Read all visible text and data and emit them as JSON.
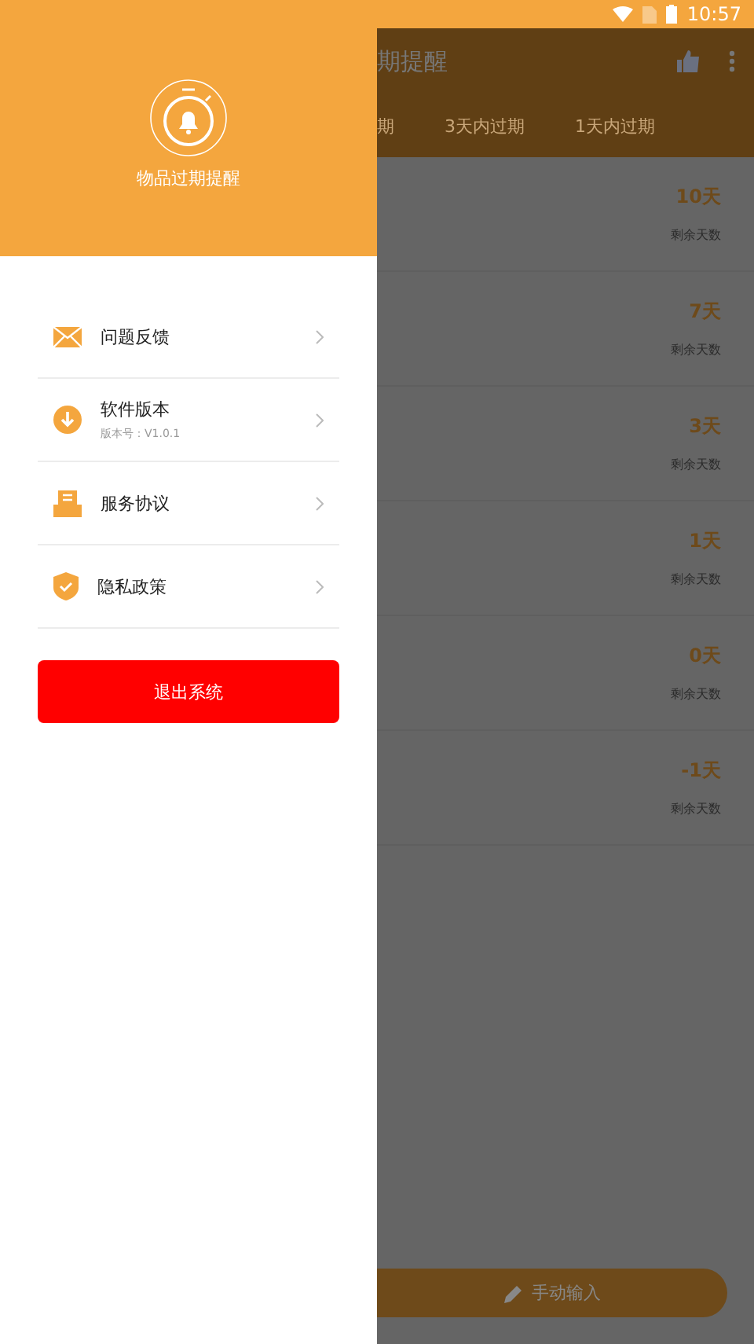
{
  "status_bar": {
    "time": "10:57"
  },
  "drawer": {
    "title": "物品过期提醒",
    "menu": [
      {
        "label": "问题反馈"
      },
      {
        "label": "软件版本",
        "subtitle": "版本号：V1.0.1"
      },
      {
        "label": "服务协议"
      },
      {
        "label": "隐私政策"
      }
    ],
    "logout": "退出系统"
  },
  "background": {
    "title": "期提醒",
    "tabs": [
      "期",
      "3天内过期",
      "1天内过期"
    ],
    "items": [
      {
        "days": "10天",
        "label": "剩余天数"
      },
      {
        "days": "7天",
        "label": "剩余天数"
      },
      {
        "days": "3天",
        "label": "剩余天数"
      },
      {
        "days": "1天",
        "label": "剩余天数"
      },
      {
        "days": "0天",
        "label": "剩余天数"
      },
      {
        "days": "-1天",
        "label": "剩余天数"
      }
    ],
    "input_button": "手动输入"
  }
}
